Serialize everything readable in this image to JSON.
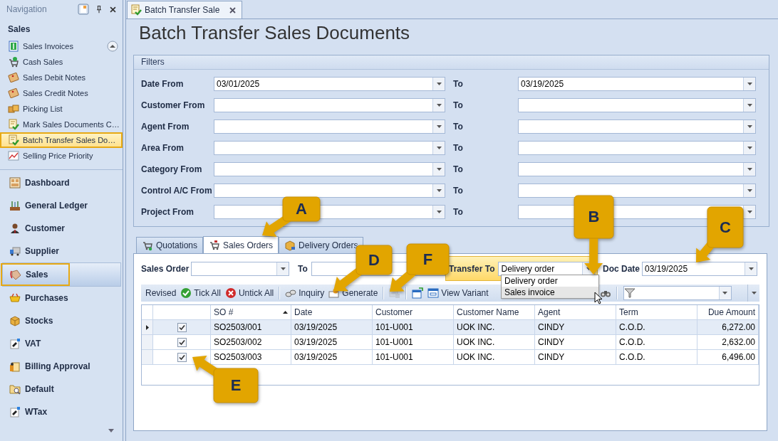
{
  "navigation": {
    "title": "Navigation",
    "section": "Sales",
    "items": [
      {
        "label": "Sales Invoices",
        "selected": false,
        "highlighted": false
      },
      {
        "label": "Cash Sales",
        "selected": false,
        "highlighted": false
      },
      {
        "label": "Sales Debit Notes",
        "selected": false,
        "highlighted": false
      },
      {
        "label": "Sales Credit Notes",
        "selected": false,
        "highlighted": false
      },
      {
        "label": "Picking List",
        "selected": false,
        "highlighted": false
      },
      {
        "label": "Mark Sales Documents C…",
        "selected": false,
        "highlighted": false
      },
      {
        "label": "Batch Transfer Sales Do…",
        "selected": true,
        "highlighted": true
      },
      {
        "label": "Selling Price Priority",
        "selected": false,
        "highlighted": false
      }
    ],
    "modules": [
      {
        "label": "Dashboard",
        "selected": false,
        "highlighted": false
      },
      {
        "label": "General Ledger",
        "selected": false,
        "highlighted": false
      },
      {
        "label": "Customer",
        "selected": false,
        "highlighted": false
      },
      {
        "label": "Supplier",
        "selected": false,
        "highlighted": false
      },
      {
        "label": "Sales",
        "selected": true,
        "highlighted": true
      },
      {
        "label": "Purchases",
        "selected": false,
        "highlighted": false
      },
      {
        "label": "Stocks",
        "selected": false,
        "highlighted": false
      },
      {
        "label": "VAT",
        "selected": false,
        "highlighted": false
      },
      {
        "label": "Billing Approval",
        "selected": false,
        "highlighted": false
      },
      {
        "label": "Default",
        "selected": false,
        "highlighted": false
      },
      {
        "label": "WTax",
        "selected": false,
        "highlighted": false
      }
    ]
  },
  "document_tab": {
    "label": "Batch Transfer Sale"
  },
  "title": "Batch Transfer Sales Documents",
  "filters": {
    "title": "Filters",
    "rows": [
      {
        "label": "Date From",
        "from": "03/01/2025",
        "to_label": "To",
        "to": "03/19/2025"
      },
      {
        "label": "Customer From",
        "to_label": "To"
      },
      {
        "label": "Agent From",
        "to_label": "To"
      },
      {
        "label": "Area From",
        "to_label": "To"
      },
      {
        "label": "Category From",
        "to_label": "To"
      },
      {
        "label": "Control A/C From",
        "to_label": "To"
      },
      {
        "label": "Project From",
        "to_label": "To"
      }
    ]
  },
  "tabs": [
    {
      "label": "Quotations",
      "selected": false
    },
    {
      "label": "Sales Orders",
      "selected": true
    },
    {
      "label": "Delivery Orders",
      "selected": false
    }
  ],
  "criteria": {
    "sales_order_label": "Sales Order",
    "to_label": "To",
    "transfer_to_label": "Transfer To",
    "transfer_to": "Delivery order",
    "transfer_to_options": [
      {
        "label": "Delivery order",
        "hovered": false
      },
      {
        "label": "Sales invoice",
        "hovered": true
      }
    ],
    "doc_date_label": "Doc Date",
    "doc_date": "03/19/2025"
  },
  "toolbar": [
    {
      "kind": "text",
      "label": "Revised"
    },
    {
      "kind": "button",
      "label": "Tick All"
    },
    {
      "kind": "button",
      "label": "Untick All"
    },
    {
      "kind": "separator"
    },
    {
      "kind": "button",
      "label": "Inquiry"
    },
    {
      "kind": "button",
      "label": "Generate"
    },
    {
      "kind": "separator"
    },
    {
      "kind": "icon",
      "disabled": true
    },
    {
      "kind": "separator"
    },
    {
      "kind": "icon"
    },
    {
      "kind": "button",
      "label": "View Variant"
    },
    {
      "kind": "icon"
    },
    {
      "kind": "separator"
    },
    {
      "kind": "filter"
    }
  ],
  "grid": {
    "columns": [
      {
        "label": "SO #",
        "sorted": true
      },
      {
        "label": "Date",
        "sorted": false
      },
      {
        "label": "Customer",
        "sorted": false
      },
      {
        "label": "Customer Name",
        "sorted": false
      },
      {
        "label": "Agent",
        "sorted": false
      },
      {
        "label": "Term",
        "sorted": false
      },
      {
        "label": "Due Amount",
        "sorted": false
      }
    ],
    "rows": [
      {
        "current": true,
        "checked": true,
        "cells": [
          "SO2503/001",
          "03/19/2025",
          "101-U001",
          "UOK INC.",
          "CINDY",
          "C.O.D.",
          "6,272.00"
        ]
      },
      {
        "current": false,
        "checked": true,
        "cells": [
          "SO2503/002",
          "03/19/2025",
          "101-U001",
          "UOK INC.",
          "CINDY",
          "C.O.D.",
          "2,632.00"
        ]
      },
      {
        "current": false,
        "checked": true,
        "cells": [
          "SO2503/003",
          "03/19/2025",
          "101-U001",
          "UOK INC.",
          "CINDY",
          "C.O.D.",
          "6,496.00"
        ]
      }
    ]
  },
  "callouts": [
    {
      "label": "A"
    },
    {
      "label": "B"
    },
    {
      "label": "C"
    },
    {
      "label": "D"
    },
    {
      "label": "F"
    },
    {
      "label": "E"
    }
  ]
}
